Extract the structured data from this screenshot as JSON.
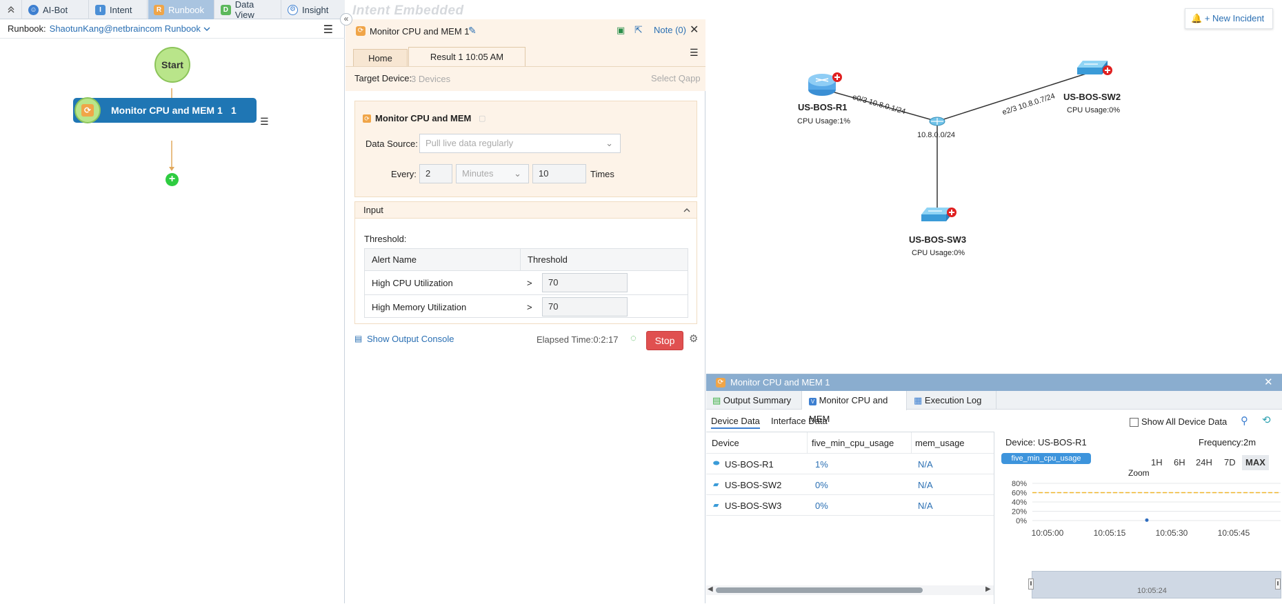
{
  "tabs": [
    {
      "label": "AI-Bot",
      "icon": "robot-icon",
      "active": false
    },
    {
      "label": "Intent",
      "icon": "intent-icon",
      "active": false
    },
    {
      "label": "Runbook",
      "icon": "runbook-icon",
      "active": true
    },
    {
      "label": "Data View",
      "icon": "data-view-icon",
      "active": false
    },
    {
      "label": "Insight",
      "icon": "insight-icon",
      "active": false
    }
  ],
  "watermark": "Intent Embedded",
  "runbook": {
    "label": "Runbook:",
    "name": "ShaotunKang@netbraincom Runbook",
    "start": "Start",
    "node_label": "Monitor CPU and MEM 1",
    "node_count": "1"
  },
  "mid": {
    "title": "Monitor CPU and MEM 1",
    "note": "Note (0)",
    "tab_home": "Home",
    "tab_result": "Result 1  10:05 AM",
    "target_label": "Target Device:",
    "target_value": "3 Devices",
    "select_qapp": "Select Qapp",
    "qapp_title": "Monitor CPU and MEM",
    "ds_label": "Data Source:",
    "ds_value": "Pull live data regularly",
    "every_label": "Every:",
    "every_value": "2",
    "unit_value": "Minutes",
    "times_value": "10",
    "times_label": "Times",
    "input_title": "Input",
    "threshold_label": "Threshold:",
    "col_alert": "Alert Name",
    "col_threshold": "Threshold",
    "rows": [
      {
        "name": "High CPU Utilization",
        "op": ">",
        "value": "70"
      },
      {
        "name": "High Memory Utilization",
        "op": ">",
        "value": "70"
      }
    ],
    "output_console": "Show Output Console",
    "elapsed": "Elapsed Time:0:2:17",
    "stop": "Stop"
  },
  "map": {
    "new_incident": "+ New Incident",
    "r1_name": "US-BOS-R1",
    "r1_cpu": "CPU Usage:1%",
    "sw2_name": "US-BOS-SW2",
    "sw2_cpu": "CPU Usage:0%",
    "sw3_name": "US-BOS-SW3",
    "sw3_cpu": "CPU Usage:0%",
    "subnet": "10.8.0.0/24",
    "link1": "e0/3 10.8.0.1/24",
    "link2": "e2/3 10.8.0.7/24"
  },
  "results": {
    "title": "Monitor CPU and MEM 1",
    "tab_output": "Output Summary",
    "tab_monitor": "Monitor CPU and MEM",
    "tab_log": "Execution Log",
    "sub_device": "Device Data",
    "sub_interface": "Interface Data",
    "show_all": "Show All Device Data",
    "col_device": "Device",
    "col_cpu": "five_min_cpu_usage",
    "col_mem": "mem_usage",
    "rows": [
      {
        "device": "US-BOS-R1",
        "cpu": "1%",
        "mem": "N/A"
      },
      {
        "device": "US-BOS-SW2",
        "cpu": "0%",
        "mem": "N/A"
      },
      {
        "device": "US-BOS-SW3",
        "cpu": "0%",
        "mem": "N/A"
      }
    ],
    "device_label": "Device: US-BOS-R1",
    "frequency": "Frequency:2m",
    "metric_tag": "five_min_cpu_usage",
    "zoom_label": "Zoom",
    "zoom_buttons": [
      "1H",
      "6H",
      "24H",
      "7D",
      "MAX"
    ],
    "zoom_active": "MAX",
    "nav_time": "10:05:24"
  },
  "chart_data": {
    "type": "line",
    "series": [
      {
        "x": [
          "10:05:24"
        ],
        "y": [
          1
        ]
      }
    ],
    "threshold": 60,
    "ylim": [
      0,
      80
    ],
    "yticks": [
      "80%",
      "60%",
      "40%",
      "20%",
      "0%"
    ],
    "xticks": [
      "10:05:00",
      "10:05:15",
      "10:05:30",
      "10:05:45"
    ],
    "grid": true,
    "colors": {
      "line": "#2f6dbf",
      "threshold": "#f0b429"
    }
  }
}
